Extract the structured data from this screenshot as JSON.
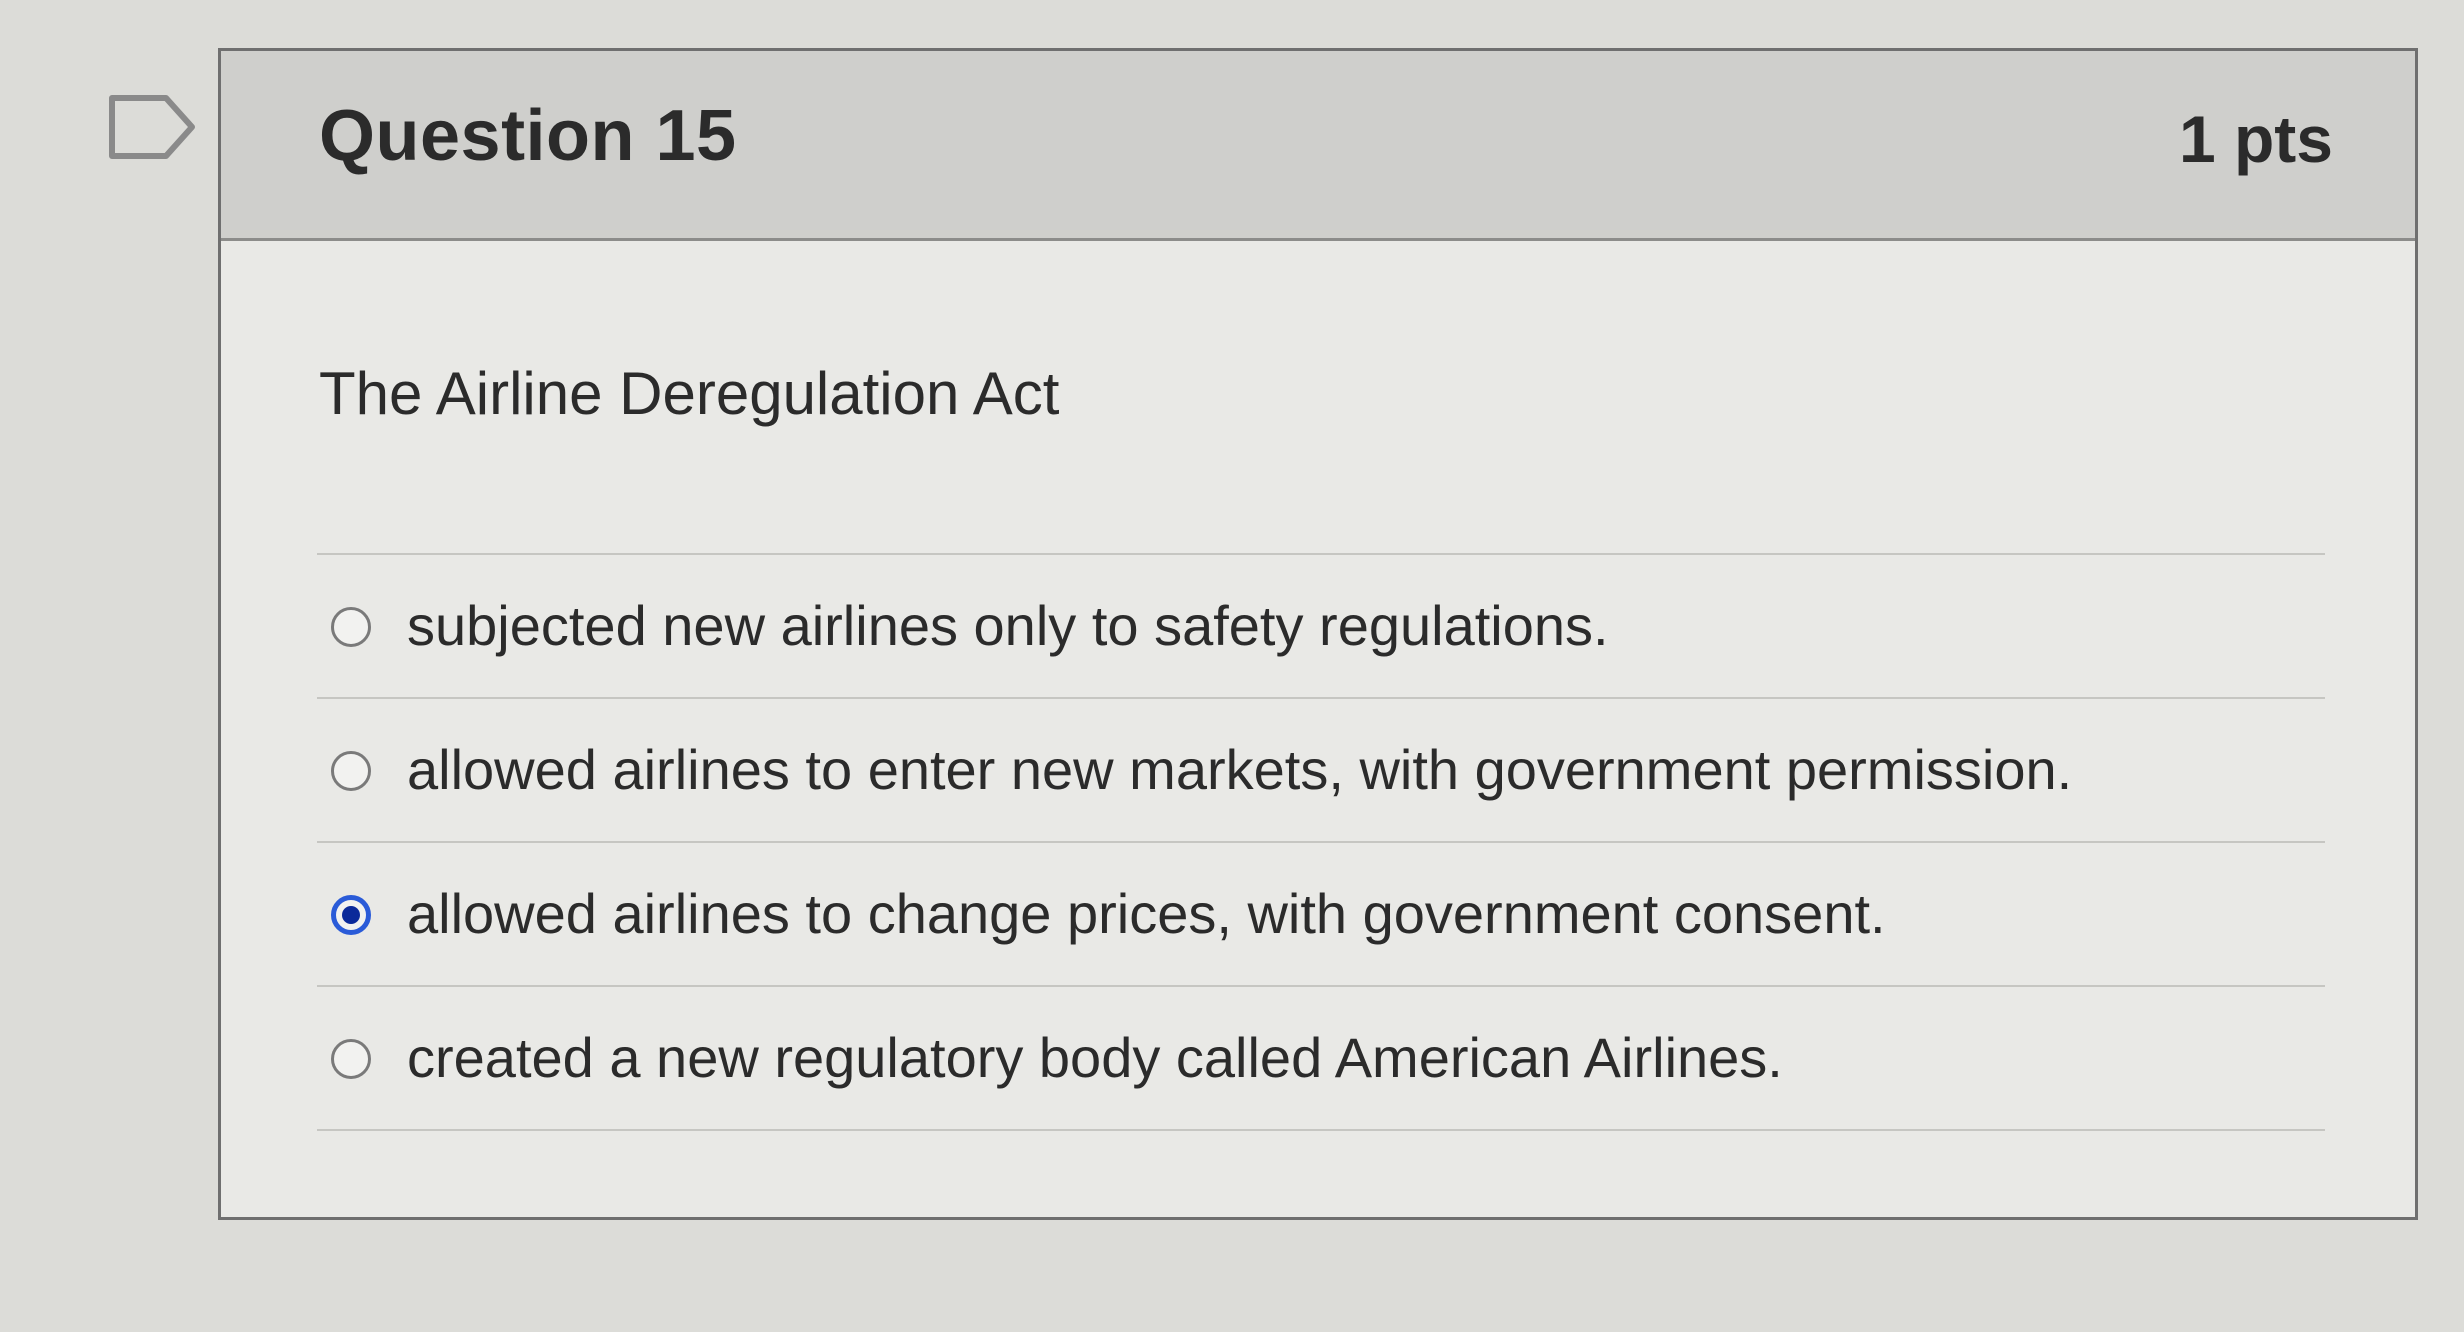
{
  "question": {
    "title": "Question 15",
    "points": "1 pts",
    "text": "The Airline Deregulation Act",
    "answers": [
      {
        "label": "subjected new airlines only to safety regulations.",
        "selected": false
      },
      {
        "label": "allowed airlines to enter new markets, with government permission.",
        "selected": false
      },
      {
        "label": "allowed airlines to change prices, with government consent.",
        "selected": true
      },
      {
        "label": "created a new regulatory body called American Airlines.",
        "selected": false
      }
    ]
  },
  "colors": {
    "selected_radio": "#2a5bd8",
    "header_background": "#cfcfcc"
  }
}
